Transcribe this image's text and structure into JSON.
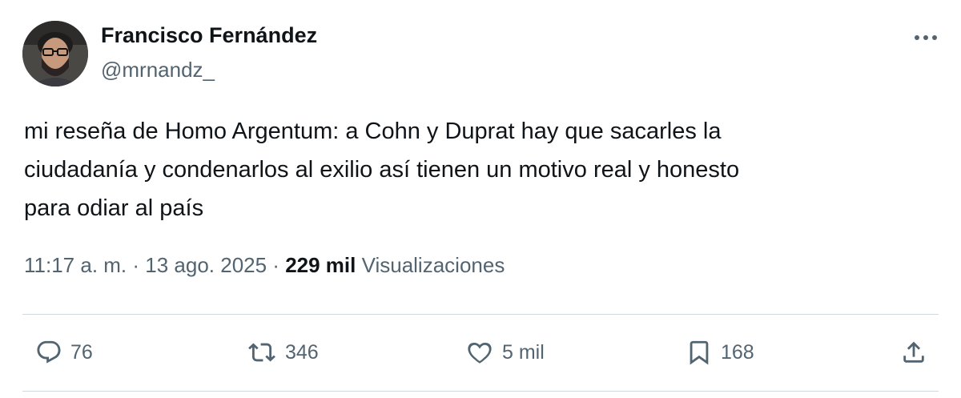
{
  "author": {
    "display_name": "Francisco Fernández",
    "handle": "@mrnandz_"
  },
  "tweet": {
    "text": "mi reseña de Homo Argentum: a Cohn y Duprat hay que sacarles la\nciudadanía y condenarlos al exilio así tienen un motivo real y honesto\npara odiar al país"
  },
  "meta": {
    "time": "11:17 a. m.",
    "separator": " · ",
    "date": "13 ago. 2025",
    "views_count": "229 mil",
    "views_label": " Visualizaciones"
  },
  "actions": {
    "replies": "76",
    "retweets": "346",
    "likes": "5 mil",
    "bookmarks": "168"
  },
  "icons": {
    "more": "more-horizontal-icon",
    "reply": "reply-icon",
    "retweet": "retweet-icon",
    "like": "heart-icon",
    "bookmark": "bookmark-icon",
    "share": "share-icon"
  },
  "colors": {
    "text": "#0f1419",
    "secondary": "#536471",
    "divider": "#cfd9de"
  }
}
